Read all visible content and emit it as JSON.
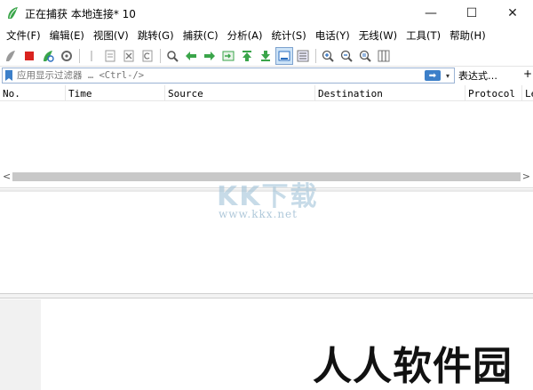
{
  "window": {
    "title": "正在捕获 本地连接* 10",
    "controls": {
      "minimize": "—",
      "maximize": "☐",
      "close": "✕"
    }
  },
  "menu": [
    "文件(F)",
    "编辑(E)",
    "视图(V)",
    "跳转(G)",
    "捕获(C)",
    "分析(A)",
    "统计(S)",
    "电话(Y)",
    "无线(W)",
    "工具(T)",
    "帮助(H)"
  ],
  "toolbar": {
    "icons": [
      "shark-fin-start-icon",
      "stop-capture-icon",
      "restart-capture-icon",
      "capture-options-icon",
      "open-file-icon",
      "save-file-icon",
      "close-file-icon",
      "reload-icon",
      "find-packet-icon",
      "go-back-icon",
      "go-forward-icon",
      "go-to-packet-icon",
      "go-first-icon",
      "go-last-icon",
      "auto-scroll-icon",
      "colorize-icon",
      "zoom-in-icon",
      "zoom-out-icon",
      "zoom-normal-icon",
      "resize-columns-icon"
    ],
    "accent_green": "#3aa54a",
    "accent_red": "#d9231f"
  },
  "filter": {
    "placeholder": "应用显示过滤器 … <Ctrl-/>",
    "expression_label": "表达式…",
    "plus_label": "+",
    "dropdown_label": "▾",
    "apply_label": "➡"
  },
  "packet_list": {
    "columns": [
      "No.",
      "Time",
      "Source",
      "Destination",
      "Protocol",
      "Le"
    ],
    "scroll_left": "<",
    "scroll_right": ">"
  },
  "watermarks": {
    "logo_text": "KK下载",
    "url_text": "www.kkx.net",
    "brand_text": "人人软件园"
  }
}
